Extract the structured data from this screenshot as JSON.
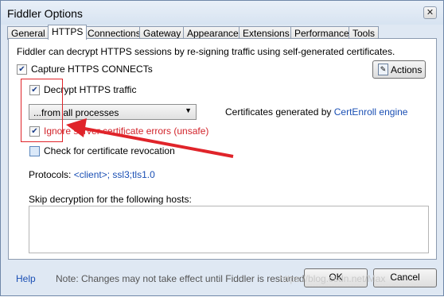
{
  "window": {
    "title": "Fiddler Options",
    "close_symbol": "✕"
  },
  "tabs": [
    {
      "label": "General",
      "active": false
    },
    {
      "label": "HTTPS",
      "active": true
    },
    {
      "label": "Connections",
      "active": false
    },
    {
      "label": "Gateway",
      "active": false
    },
    {
      "label": "Appearance",
      "active": false
    },
    {
      "label": "Extensions",
      "active": false
    },
    {
      "label": "Performance",
      "active": false
    },
    {
      "label": "Tools",
      "active": false
    }
  ],
  "https": {
    "intro": "Fiddler can decrypt HTTPS sessions by re-signing traffic using self-generated certificates.",
    "capture_label": "Capture HTTPS CONNECTs",
    "capture_checked": true,
    "actions_label": "Actions",
    "decrypt_label": "Decrypt HTTPS traffic",
    "decrypt_checked": true,
    "process_filter_value": "...from all processes",
    "cert_text": "Certificates generated by ",
    "cert_engine_link": "CertEnroll engine",
    "ignore_errors_label": "Ignore server certificate errors (unsafe)",
    "ignore_errors_checked": true,
    "revocation_label": "Check for certificate revocation",
    "revocation_checked": false,
    "protocols_label": "Protocols: ",
    "protocols_value": "<client>; ssl3;tls1.0",
    "skip_label": "Skip decryption for the following hosts:",
    "skip_hosts_value": ""
  },
  "footer": {
    "help_label": "Help",
    "note": "Note: Changes may not take effect until Fiddler is restarted.",
    "ok_label": "OK",
    "cancel_label": "Cancel",
    "watermark": "https://blog.csdn.net/Max"
  },
  "colors": {
    "annotation_red": "#e0242a",
    "link_blue": "#1a4fb4"
  }
}
